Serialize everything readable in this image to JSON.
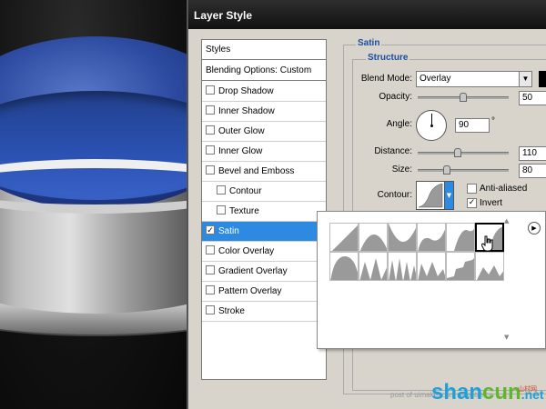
{
  "dialog": {
    "title": "Layer Style"
  },
  "styles_list": {
    "header": "Styles",
    "blending_options": "Blending Options: Custom",
    "items": [
      {
        "label": "Drop Shadow",
        "checked": false
      },
      {
        "label": "Inner Shadow",
        "checked": false
      },
      {
        "label": "Outer Glow",
        "checked": false
      },
      {
        "label": "Inner Glow",
        "checked": false
      },
      {
        "label": "Bevel and Emboss",
        "checked": false
      },
      {
        "label": "Contour",
        "checked": false
      },
      {
        "label": "Texture",
        "checked": false
      },
      {
        "label": "Satin",
        "checked": true
      },
      {
        "label": "Color Overlay",
        "checked": false
      },
      {
        "label": "Gradient Overlay",
        "checked": false
      },
      {
        "label": "Pattern Overlay",
        "checked": false
      },
      {
        "label": "Stroke",
        "checked": false
      }
    ],
    "selected": "Satin"
  },
  "satin": {
    "section_title": "Satin",
    "structure_title": "Structure",
    "blend_mode": {
      "label": "Blend Mode:",
      "value": "Overlay"
    },
    "opacity": {
      "label": "Opacity:",
      "value": "50",
      "percent": 50
    },
    "angle": {
      "label": "Angle:",
      "value": "90",
      "unit": "°"
    },
    "distance": {
      "label": "Distance:",
      "value": "110",
      "percent": 44
    },
    "size": {
      "label": "Size:",
      "value": "80",
      "percent": 32
    },
    "contour": {
      "label": "Contour:"
    },
    "anti_aliased": {
      "label": "Anti-aliased",
      "checked": false
    },
    "invert": {
      "label": "Invert",
      "checked": true
    }
  },
  "icons": {
    "dropdown_arrow": "▼",
    "check": "✓",
    "scroll_up": "▲",
    "scroll_down": "▼",
    "menu": "▶"
  },
  "watermark": {
    "text": "post of uimaker.com  uicentre.cc",
    "logo_blue": "shan",
    "logo_green": "cun",
    "logo_suffix": ".net",
    "small": "山村网"
  }
}
